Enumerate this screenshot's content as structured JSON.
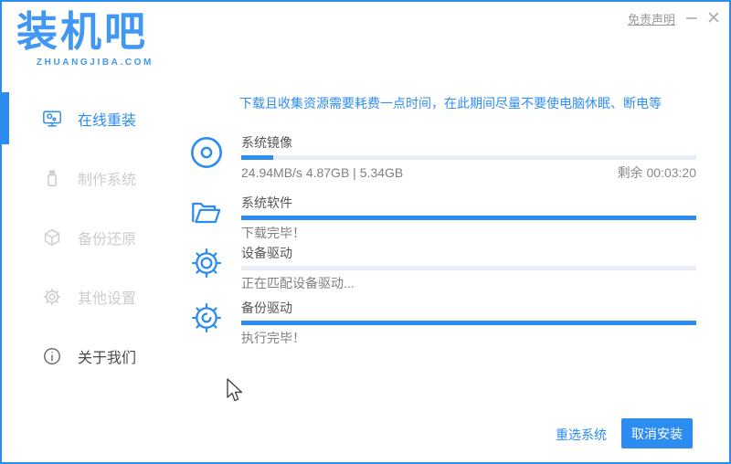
{
  "colors": {
    "accent": "#2d8cf0",
    "logo_blue": "#4198f3",
    "track": "#e9eef6",
    "notice_blue": "#2f8df4"
  },
  "header": {
    "logo_text": "装机吧",
    "logo_sub": "ZHUANGJIBA.COM",
    "disclaimer": "免责声明",
    "icons": [
      "minimize-icon",
      "close-icon"
    ]
  },
  "sidebar": {
    "items": [
      {
        "label": "在线重装",
        "icon": "monitor-icon",
        "active": true
      },
      {
        "label": "制作系统",
        "icon": "usb-drive-icon",
        "active": false
      },
      {
        "label": "备份还原",
        "icon": "backup-box-icon",
        "active": false
      },
      {
        "label": "其他设置",
        "icon": "settings-gear-icon",
        "active": false
      },
      {
        "label": "关于我们",
        "icon": "info-icon",
        "active": false
      }
    ]
  },
  "main": {
    "notice": "下载且收集资源需要耗费一点时间，在此期间尽量不要使电脑休眠、断电等",
    "tasks": [
      {
        "name": "系统镜像",
        "icon": "disc-icon",
        "progress": 7,
        "status": "24.94MB/s 4.87GB | 5.34GB",
        "remaining": "剩余 00:03:20"
      },
      {
        "name": "系统软件",
        "icon": "open-folder-icon",
        "progress": 100,
        "status": "下载完毕！"
      },
      {
        "name": "设备驱动",
        "icon": "gear-icon",
        "progress": 0,
        "status": "正在匹配设备驱动..."
      },
      {
        "name": "备份驱动",
        "icon": "gear-sync-icon",
        "progress": 100,
        "status": "执行完毕！"
      }
    ]
  },
  "footer": {
    "reselect_label": "重选系统",
    "cancel_label": "取消安装"
  }
}
